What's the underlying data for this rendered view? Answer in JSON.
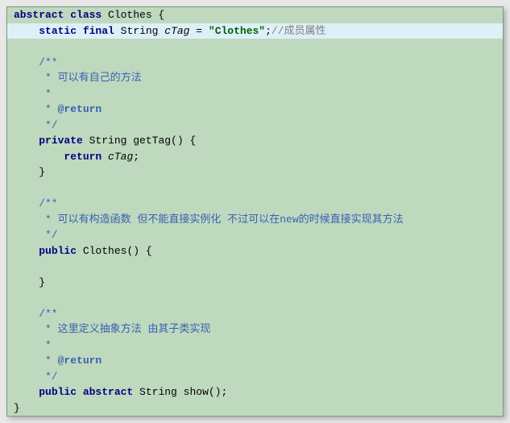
{
  "code": {
    "l1_kw1": "abstract class",
    "l1_name": " Clothes {",
    "l2_kw": "static final",
    "l2_type": " String ",
    "l2_field": "cTag",
    "l2_eq": " = ",
    "l2_str": "\"Clothes\"",
    "l2_semi": ";",
    "l2_comment": "//成员属性",
    "jd1_open": "    /**",
    "jd1_l1": "     * 可以有自己的方法",
    "jd1_l2": "     *",
    "jd1_l3a": "     * ",
    "jd1_l3b": "@return",
    "jd1_close": "     */",
    "m1_kw": "private",
    "m1_type": " String ",
    "m1_sig": "getTag() {",
    "m1_ret_kw": "return",
    "m1_ret_sp": " ",
    "m1_ret_field": "cTag",
    "m1_ret_semi": ";",
    "m1_close": "    }",
    "jd2_open": "    /**",
    "jd2_l1": "     * 可以有构造函数 但不能直接实例化 不过可以在new的时候直接实现其方法",
    "jd2_close": "     */",
    "c1_kw": "public",
    "c1_sig": " Clothes() {",
    "c1_close": "    }",
    "jd3_open": "    /**",
    "jd3_l1": "     * 这里定义抽象方法 由其子类实现",
    "jd3_l2": "     *",
    "jd3_l3a": "     * ",
    "jd3_l3b": "@return",
    "jd3_close": "     */",
    "m2_kw": "public abstract",
    "m2_type": " String ",
    "m2_sig": "show();",
    "class_close": "}"
  }
}
